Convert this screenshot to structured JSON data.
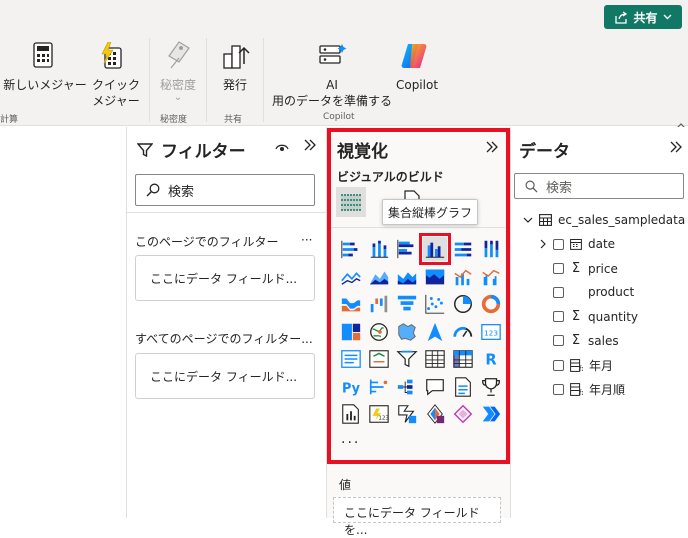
{
  "topbar": {
    "share_label": "共有"
  },
  "ribbon": {
    "new_measure": "新しいメジャー",
    "quick_measure_1": "クイック",
    "quick_measure_2": "メジャー",
    "sensitivity": "秘密度",
    "publish": "発行",
    "ai_prep_1": "AI",
    "ai_prep_2": "用のデータを準備する",
    "copilot": "Copilot",
    "group_calc": "計算",
    "group_sensitivity": "秘密度",
    "group_share": "共有",
    "group_copilot": "Copilot"
  },
  "filters": {
    "title": "フィルター",
    "search_placeholder": "検索",
    "this_page_label": "このページでのフィルター",
    "this_page_dots": "···",
    "this_page_drop": "ここにデータ フィールド...",
    "all_pages_label": "すべてのページでのフィルター...",
    "all_pages_drop": "ここにデータ フィールド..."
  },
  "viz": {
    "title": "視覚化",
    "build_label": "ビジュアルのビルド",
    "tooltip": "集合縦棒グラフ",
    "values_label": "値",
    "values_drop": "ここにデータ フィールドを...",
    "more": "···"
  },
  "data": {
    "title": "データ",
    "search_placeholder": "検索",
    "table_name": "ec_sales_sampledata",
    "fields": [
      {
        "name": "date",
        "icon": "calendar"
      },
      {
        "name": "price",
        "icon": "sigma"
      },
      {
        "name": "product",
        "icon": "none"
      },
      {
        "name": "quantity",
        "icon": "sigma"
      },
      {
        "name": "sales",
        "icon": "sigma"
      },
      {
        "name": "年月",
        "icon": "calc"
      },
      {
        "name": "年月順",
        "icon": "calc"
      }
    ]
  },
  "colors": {
    "accent_red": "#e81123",
    "share_green": "#117865",
    "viz_blue": "#118dff"
  }
}
